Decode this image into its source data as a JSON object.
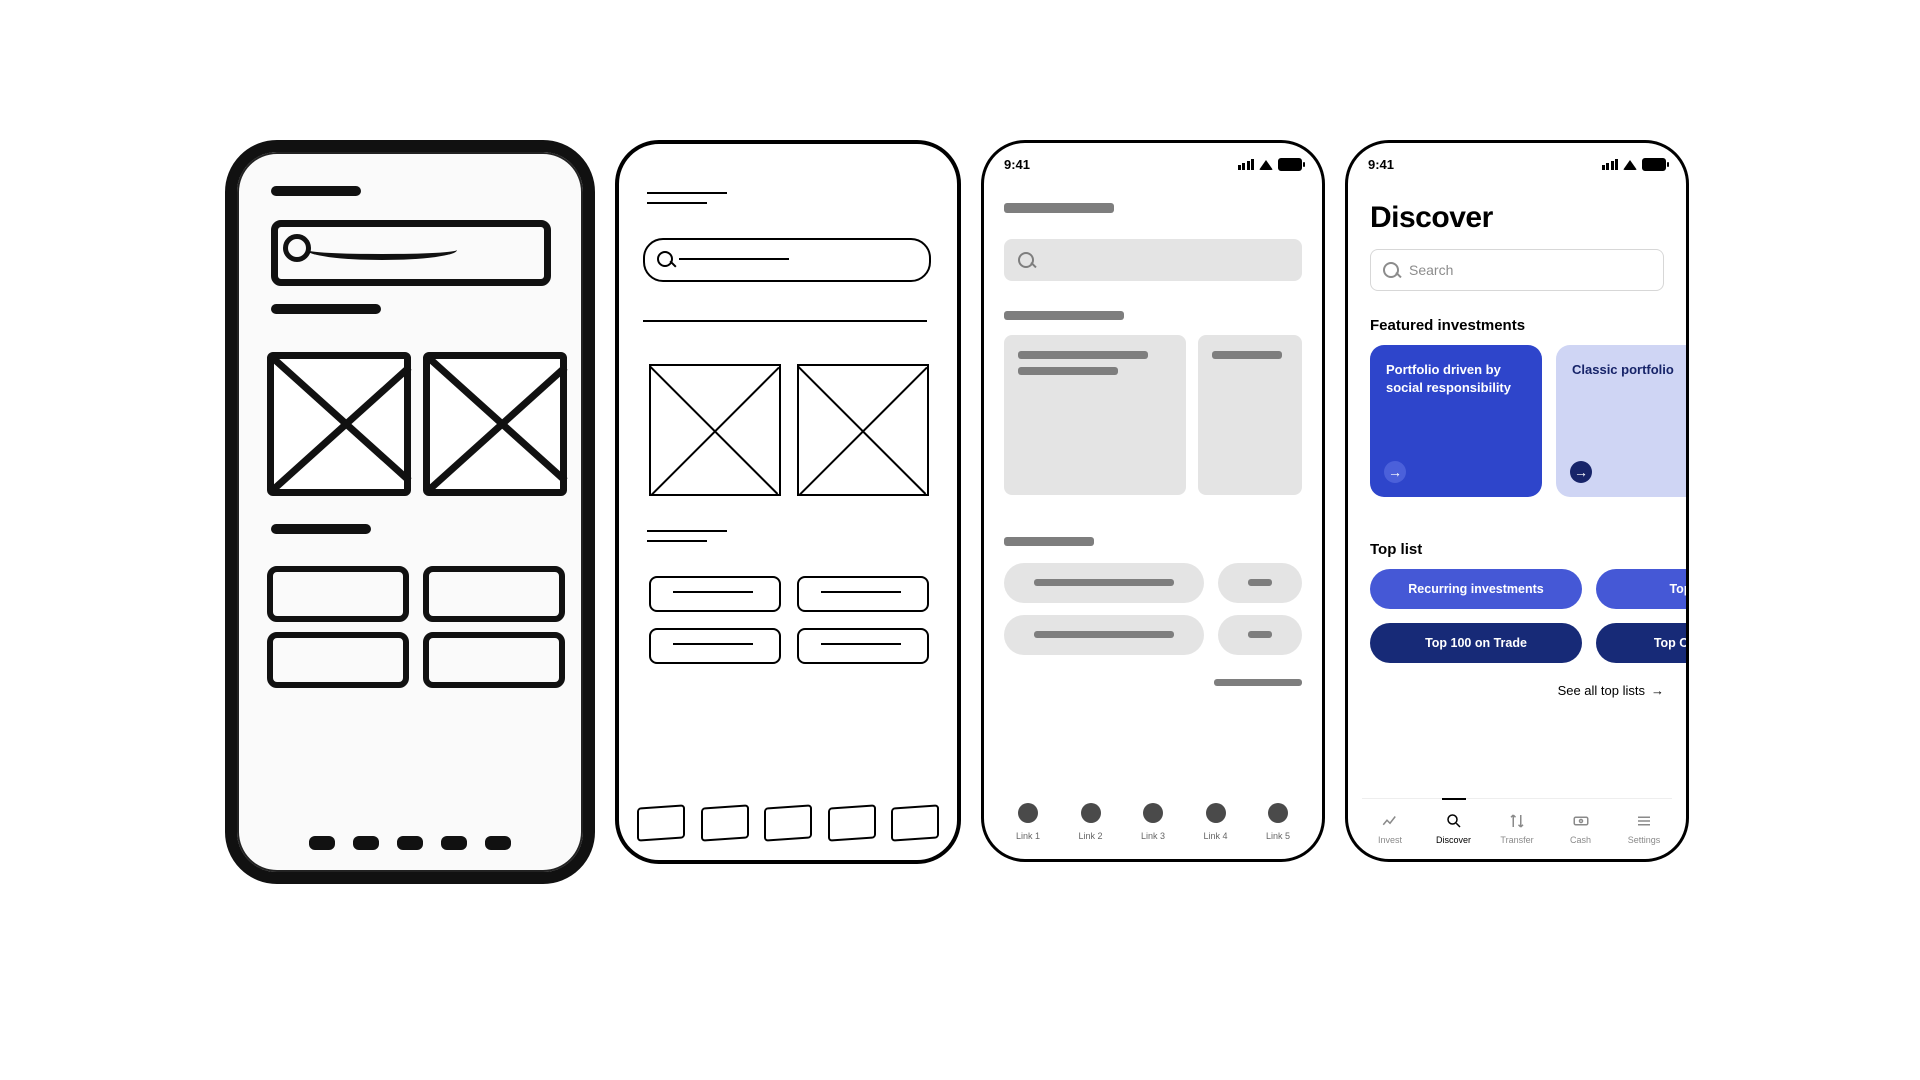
{
  "status_time": "9:41",
  "wire3": {
    "tabs": [
      "Link 1",
      "Link 2",
      "Link 3",
      "Link 4",
      "Link 5"
    ]
  },
  "hifi": {
    "title": "Discover",
    "search_placeholder": "Search",
    "featured_label": "Featured investments",
    "cards": [
      {
        "title": "Portfolio driven by social responsibility"
      },
      {
        "title": "Classic portfolio"
      }
    ],
    "toplist_label": "Top list",
    "pills": [
      "Recurring investments",
      "Top US sto",
      "Top 100 on Trade",
      "Top Canadian st"
    ],
    "see_all": "See all top lists",
    "tabs": [
      "Invest",
      "Discover",
      "Transfer",
      "Cash",
      "Settings"
    ],
    "active_tab": 1
  }
}
